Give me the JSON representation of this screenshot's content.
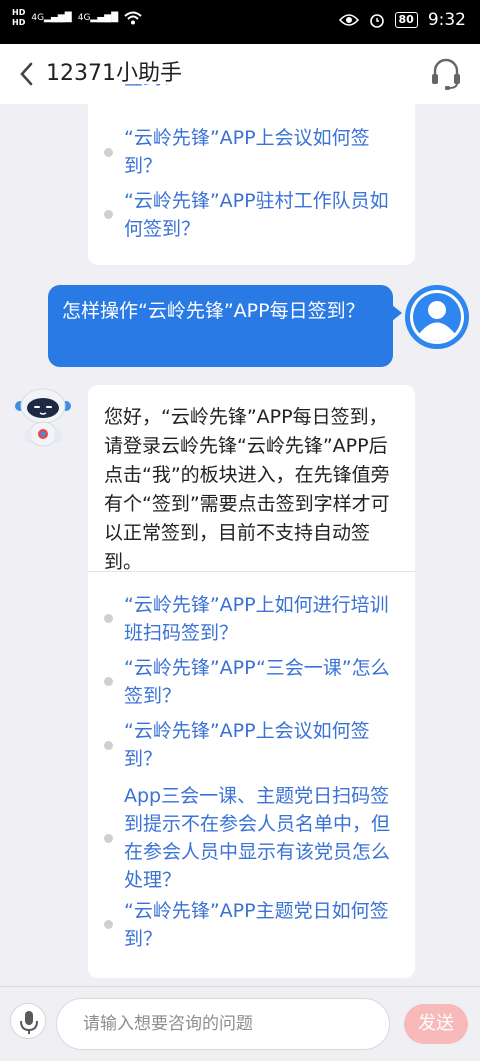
{
  "status_bar": {
    "network_left": "HD 4G",
    "network_right": "HD 4G",
    "battery": "80",
    "time": "9:32"
  },
  "header": {
    "title": "12371小助手"
  },
  "top_card": {
    "cut_text": "签到？",
    "options": [
      "“云岭先锋”APP上会议如何签到？",
      "“云岭先锋”APP驻村工作队员如何签到？"
    ]
  },
  "user_message": "怎样操作“云岭先锋”APP每日签到？",
  "bot_reply": {
    "answer": "您好，“云岭先锋”APP每日签到，请登录云岭先锋“云岭先锋”APP后点击“我”的板块进入，在先锋值旁有个“签到”需要点击签到字样才可以正常签到，目前不支持自动签到。",
    "options": [
      "“云岭先锋”APP上如何进行培训班扫码签到？",
      "“云岭先锋”APP“三会一课”怎么签到？",
      "“云岭先锋”APP上会议如何签到？",
      "App三会一课、主题党日扫码签到提示不在参会人员名单中，但在参会人员中显示有该党员怎么处理？",
      "“云岭先锋”APP主题党日如何签到？"
    ]
  },
  "input_bar": {
    "placeholder": "请输入想要咨询的问题",
    "send_label": "发送"
  },
  "colors": {
    "accent": "#2a7ae6",
    "link": "#3a72d6",
    "send_disabled": "#f7b9b9"
  }
}
